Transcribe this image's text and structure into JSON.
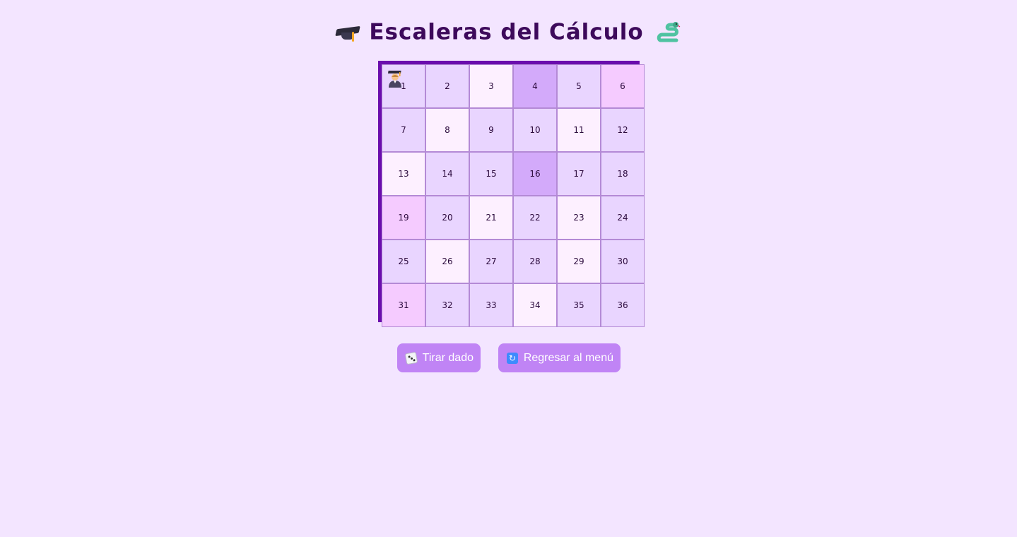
{
  "header": {
    "title": "Escaleras del Cálculo",
    "left_icon": "graduation-cap-icon",
    "right_icon": "snake-icon"
  },
  "board": {
    "player_icon": "student-icon",
    "player_position": 1,
    "cells": [
      {
        "label": "1",
        "tone": "a"
      },
      {
        "label": "2",
        "tone": "a"
      },
      {
        "label": "3",
        "tone": "b"
      },
      {
        "label": "4",
        "tone": "c"
      },
      {
        "label": "5",
        "tone": "a"
      },
      {
        "label": "6",
        "tone": "d"
      },
      {
        "label": "7",
        "tone": "a"
      },
      {
        "label": "8",
        "tone": "b"
      },
      {
        "label": "9",
        "tone": "a"
      },
      {
        "label": "10",
        "tone": "a"
      },
      {
        "label": "11",
        "tone": "b"
      },
      {
        "label": "12",
        "tone": "a"
      },
      {
        "label": "13",
        "tone": "b"
      },
      {
        "label": "14",
        "tone": "a"
      },
      {
        "label": "15",
        "tone": "a"
      },
      {
        "label": "16",
        "tone": "c"
      },
      {
        "label": "17",
        "tone": "a"
      },
      {
        "label": "18",
        "tone": "a"
      },
      {
        "label": "19",
        "tone": "d"
      },
      {
        "label": "20",
        "tone": "a"
      },
      {
        "label": "21",
        "tone": "b"
      },
      {
        "label": "22",
        "tone": "a"
      },
      {
        "label": "23",
        "tone": "b"
      },
      {
        "label": "24",
        "tone": "a"
      },
      {
        "label": "25",
        "tone": "a"
      },
      {
        "label": "26",
        "tone": "b"
      },
      {
        "label": "27",
        "tone": "a"
      },
      {
        "label": "28",
        "tone": "a"
      },
      {
        "label": "29",
        "tone": "b"
      },
      {
        "label": "30",
        "tone": "a"
      },
      {
        "label": "31",
        "tone": "d"
      },
      {
        "label": "32",
        "tone": "a"
      },
      {
        "label": "33",
        "tone": "a"
      },
      {
        "label": "34",
        "tone": "b"
      },
      {
        "label": "35",
        "tone": "a"
      },
      {
        "label": "36",
        "tone": "a"
      }
    ]
  },
  "actions": {
    "roll_label": "Tirar dado",
    "roll_icon": "dice-icon",
    "menu_label": "Regresar al menú",
    "menu_icon": "refresh-icon"
  },
  "colors": {
    "background": "#f3e5ff",
    "board_border": "#6a0dad",
    "button": "#c084f5",
    "title": "#3d0a5b"
  }
}
